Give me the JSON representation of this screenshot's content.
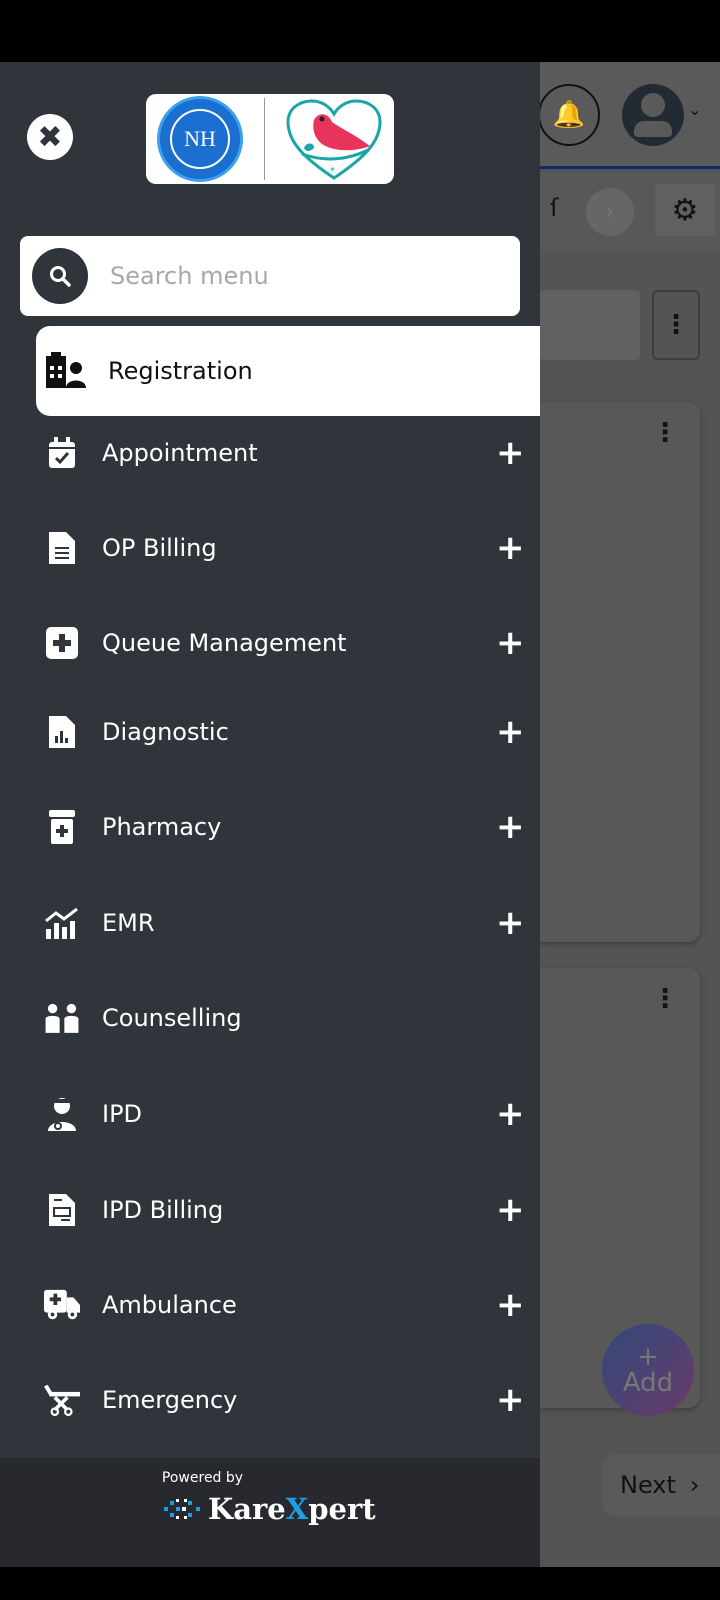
{
  "logo": {
    "left_text": "NH"
  },
  "search": {
    "placeholder": "Search menu",
    "value": ""
  },
  "menu": {
    "active": {
      "label": "Registration",
      "icon": "hospital-user-icon"
    },
    "items": [
      {
        "label": "Appointment",
        "icon": "calendar-check-icon",
        "expandable": true
      },
      {
        "label": "OP Billing",
        "icon": "file-lines-icon",
        "expandable": true
      },
      {
        "label": "Queue Management",
        "icon": "square-plus-icon",
        "expandable": true
      },
      {
        "label": "Diagnostic",
        "icon": "file-chart-icon",
        "expandable": true
      },
      {
        "label": "Pharmacy",
        "icon": "prescription-bottle-icon",
        "expandable": true
      },
      {
        "label": "EMR",
        "icon": "chart-line-icon",
        "expandable": true
      },
      {
        "label": "Counselling",
        "icon": "people-icon",
        "expandable": false
      },
      {
        "label": "IPD",
        "icon": "user-doctor-icon",
        "expandable": true
      },
      {
        "label": "IPD Billing",
        "icon": "file-invoice-icon",
        "expandable": true
      },
      {
        "label": "Ambulance",
        "icon": "truck-medical-icon",
        "expandable": true
      },
      {
        "label": "Emergency",
        "icon": "stretcher-icon",
        "expandable": true
      }
    ],
    "plus_glyph": "+"
  },
  "footer": {
    "powered_by": "Powered by",
    "brand_a": "Kare",
    "brand_b": "X",
    "brand_c": "pert"
  },
  "background": {
    "add_label": "Add",
    "add_glyph": "+",
    "next_label": "Next",
    "next_glyph": "›",
    "partial_text": "ſ"
  },
  "colors": {
    "drawer": "#30343b",
    "footer": "#27292e",
    "brand_accent": "#1aa0e6",
    "bird": "#e8345a",
    "heart": "#1aa6a6"
  }
}
